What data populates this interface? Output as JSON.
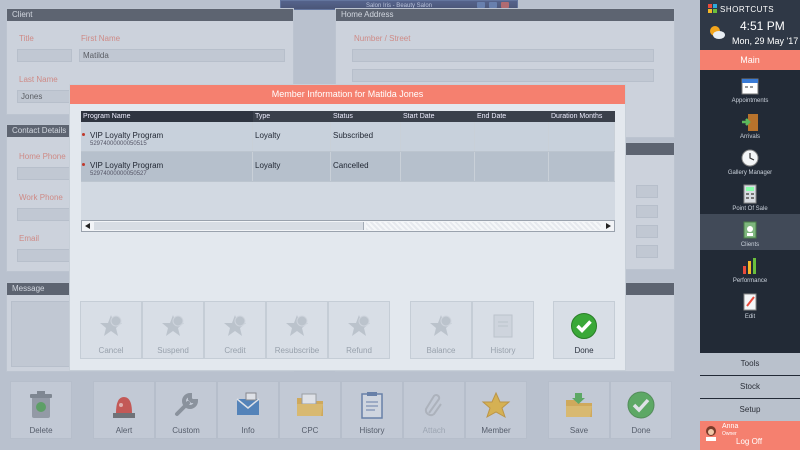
{
  "window_title": "Salon Iris - Beauty Salon",
  "background": {
    "client": {
      "header": "Client",
      "title_label": "Title",
      "first_name_label": "First Name",
      "first_name_value": "Matilda",
      "last_name_label": "Last Name",
      "last_name_value": "Jones"
    },
    "home_address": {
      "header": "Home Address",
      "number_street_label": "Number / Street"
    },
    "contact_details": {
      "header": "Contact Details",
      "home_phone_label": "Home Phone",
      "work_phone_label": "Work Phone",
      "email_label": "Email"
    },
    "message": {
      "header": "Message"
    }
  },
  "toolbar": {
    "delete": "Delete",
    "alert": "Alert",
    "custom": "Custom",
    "info": "Info",
    "cpc": "CPC",
    "history": "History",
    "attach": "Attach",
    "member": "Member",
    "save": "Save",
    "done": "Done"
  },
  "sidebar": {
    "title": "SHORTCUTS",
    "time": "4:51 PM",
    "date": "Mon, 29 May '17",
    "main_label": "Main",
    "items": [
      {
        "label": "Appointments",
        "icon": "calendar-icon"
      },
      {
        "label": "Arrivals",
        "icon": "door-icon"
      },
      {
        "label": "Gallery Manager",
        "icon": "clock-icon"
      },
      {
        "label": "Point Of Sale",
        "icon": "calculator-icon"
      },
      {
        "label": "Clients",
        "icon": "clients-icon"
      },
      {
        "label": "Performance",
        "icon": "chart-icon"
      },
      {
        "label": "Edit",
        "icon": "edit-icon"
      }
    ],
    "tools_label": "Tools",
    "stock_label": "Stock",
    "setup_label": "Setup",
    "user_name": "Anna",
    "user_role": "Owner",
    "log_off": "Log Off"
  },
  "modal": {
    "title": "Member Information for Matilda Jones",
    "columns": [
      "Program Name",
      "Type",
      "Status",
      "Start Date",
      "End Date",
      "Duration Months"
    ],
    "rows": [
      {
        "program": "VIP Loyalty Program",
        "id": "52974000000050515",
        "type": "Loyalty",
        "status": "Subscribed",
        "start": "",
        "end": "",
        "duration": ""
      },
      {
        "program": "VIP Loyalty Program",
        "id": "52974000000050527",
        "type": "Loyalty",
        "status": "Cancelled",
        "start": "",
        "end": "",
        "duration": ""
      }
    ],
    "buttons": {
      "cancel": "Cancel",
      "suspend": "Suspend",
      "credit": "Credit",
      "resubscribe": "Resubscribe",
      "refund": "Refund",
      "balance": "Balance",
      "history": "History",
      "done": "Done"
    }
  },
  "colors": {
    "accent": "#f5806f",
    "header_dark": "#3a404b",
    "sidebar_bg": "#222a36",
    "done_green": "#3aa838"
  }
}
